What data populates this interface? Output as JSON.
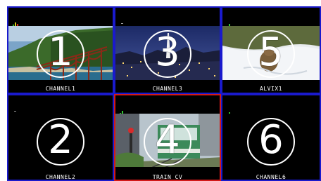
{
  "cells": [
    {
      "number": "1",
      "label": "CHANNEL1",
      "selected": false
    },
    {
      "number": "3",
      "label": "CHANNEL3",
      "selected": false
    },
    {
      "number": "5",
      "label": "ALVIX1",
      "selected": false
    },
    {
      "number": "2",
      "label": "CHANNEL2",
      "selected": false
    },
    {
      "number": "4",
      "label": "TRAIN CV",
      "selected": true
    },
    {
      "number": "6",
      "label": "CHANNEL6",
      "selected": false
    }
  ],
  "colors": {
    "frame": "#1a1acc",
    "selected_frame": "#d21a1a",
    "level_green": "#2ec82e",
    "level_yellow": "#d8c818",
    "level_red": "#d8281e"
  },
  "icons": {
    "audio_level": "audio-level-meter-icon"
  }
}
